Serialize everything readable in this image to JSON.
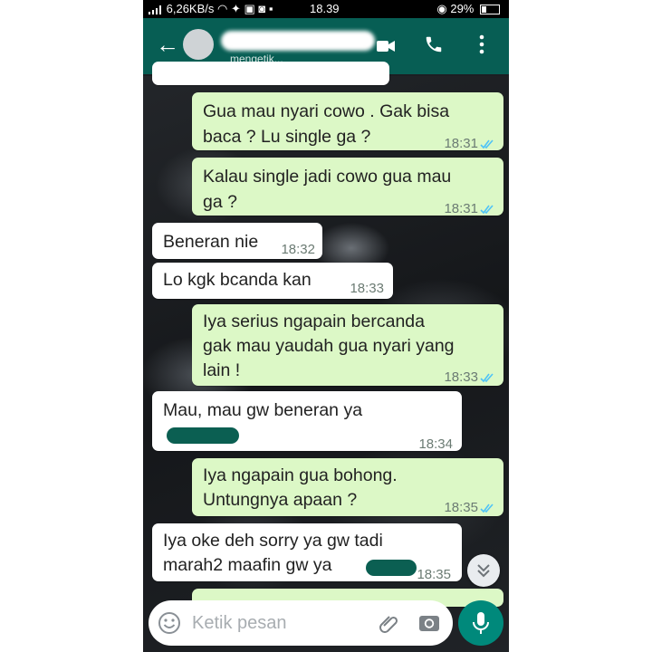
{
  "status_bar": {
    "network_speed": "6,26KB/s",
    "time": "18.39",
    "battery": "29%"
  },
  "header": {
    "typing_status": "mengetik..."
  },
  "messages": [
    {
      "dir": "out",
      "lines": [
        "Gua mau nyari cowo . Gak bisa",
        "baca ? Lu single ga ?"
      ],
      "time": "18:31"
    },
    {
      "dir": "out",
      "lines": [
        "Kalau single jadi cowo gua mau",
        "ga ?"
      ],
      "time": "18:31"
    },
    {
      "dir": "in",
      "lines": [
        "Beneran nie"
      ],
      "time": "18:32"
    },
    {
      "dir": "in",
      "lines": [
        "Lo kgk bcanda kan"
      ],
      "time": "18:33"
    },
    {
      "dir": "out",
      "lines": [
        "Iya serius ngapain bercanda",
        "gak mau yaudah gua nyari yang",
        "lain !"
      ],
      "time": "18:33"
    },
    {
      "dir": "in",
      "lines": [
        "Mau, mau gw beneran ya"
      ],
      "time": "18:34"
    },
    {
      "dir": "out",
      "lines": [
        "Iya ngapain gua bohong.",
        "Untungnya apaan ?"
      ],
      "time": "18:35"
    },
    {
      "dir": "in",
      "lines": [
        "Iya oke deh sorry ya gw tadi",
        "marah2 maafin gw ya"
      ],
      "time": "18:35"
    }
  ],
  "composer": {
    "placeholder": "Ketik pesan"
  }
}
